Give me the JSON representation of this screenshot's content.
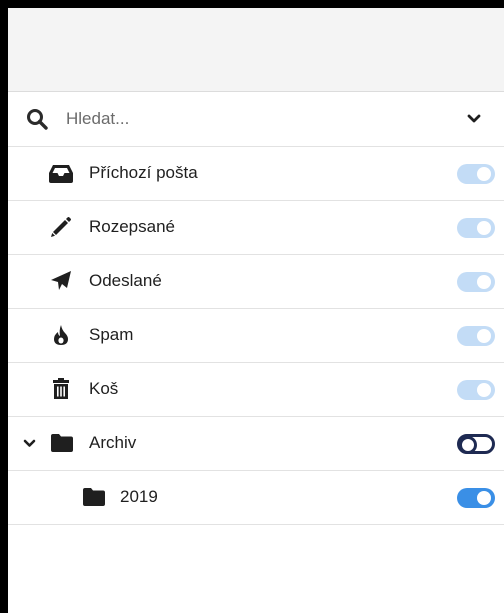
{
  "search": {
    "placeholder": "Hledat...",
    "icon": "search-icon"
  },
  "folders": [
    {
      "label": "Příchozí pošta",
      "icon": "inbox-icon",
      "toggle": "on-disabled"
    },
    {
      "label": "Rozepsané",
      "icon": "pencil-icon",
      "toggle": "on-disabled"
    },
    {
      "label": "Odeslané",
      "icon": "paper-plane-icon",
      "toggle": "on-disabled"
    },
    {
      "label": "Spam",
      "icon": "fire-icon",
      "toggle": "on-disabled"
    },
    {
      "label": "Koš",
      "icon": "trash-icon",
      "toggle": "on-disabled"
    },
    {
      "label": "Archiv",
      "icon": "folder-icon",
      "toggle": "off",
      "expanded": true
    },
    {
      "label": "2019",
      "icon": "folder-icon",
      "toggle": "on"
    }
  ],
  "colors": {
    "toggle_on": "#3a8fe6",
    "toggle_disabled": "#c3dcf6",
    "toggle_off_border": "#1e2a52",
    "header_bg": "#f4f4f4"
  }
}
